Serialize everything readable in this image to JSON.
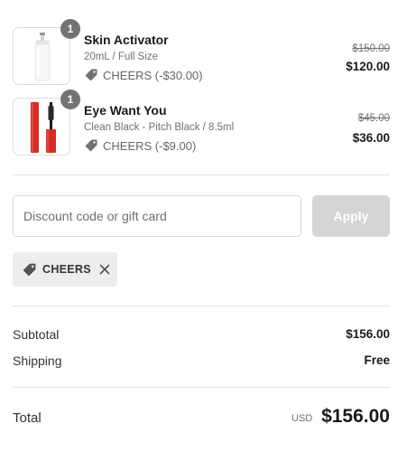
{
  "items": [
    {
      "quantity": "1",
      "name": "Skin Activator",
      "variant": "20mL / Full Size",
      "discount": "CHEERS (-$30.00)",
      "original_price": "$150.00",
      "price": "$120.00",
      "image_icon": "white-pump-bottle"
    },
    {
      "quantity": "1",
      "name": "Eye Want You",
      "variant": "Clean Black - Pitch Black / 8.5ml",
      "discount": "CHEERS (-$9.00)",
      "original_price": "$45.00",
      "price": "$36.00",
      "image_icon": "red-mascara-tube"
    }
  ],
  "discount_form": {
    "placeholder": "Discount code or gift card",
    "apply_label": "Apply"
  },
  "applied_code": {
    "code": "CHEERS"
  },
  "summary": {
    "subtotal_label": "Subtotal",
    "subtotal_value": "$156.00",
    "shipping_label": "Shipping",
    "shipping_value": "Free",
    "total_label": "Total",
    "currency": "USD",
    "total_value": "$156.00"
  },
  "colors": {
    "badge": "#737373",
    "apply_disabled": "#d5d5d5",
    "chip_bg": "#ededed",
    "product_red": "#d62b25"
  }
}
